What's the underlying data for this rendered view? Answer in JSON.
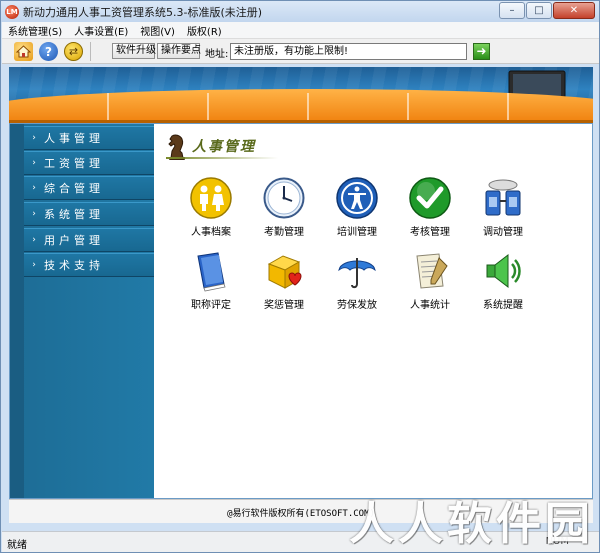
{
  "window": {
    "title": "新动力通用人事工资管理系统5.3-标准版(未注册)",
    "minimize": "–",
    "maximize": "□",
    "close": "✕"
  },
  "menu": [
    "系统管理(S)",
    "人事设置(E)",
    "视图(V)",
    "版权(R)"
  ],
  "toolbar": {
    "upgrade_label": "软件升级",
    "points_label": "操作要点",
    "address_label": "地址:",
    "address_value": "未注册版，有功能上限制!",
    "go_icon": "arrow-right-icon"
  },
  "sidebar": {
    "items": [
      {
        "label": "人事管理"
      },
      {
        "label": "工资管理"
      },
      {
        "label": "综合管理"
      },
      {
        "label": "系统管理"
      },
      {
        "label": "用户管理"
      },
      {
        "label": "技术支持"
      }
    ]
  },
  "content": {
    "section_title": "人事管理",
    "items": [
      {
        "label": "人事档案",
        "icon": "people-icon"
      },
      {
        "label": "考勤管理",
        "icon": "clock-icon"
      },
      {
        "label": "培训管理",
        "icon": "accessibility-icon"
      },
      {
        "label": "考核管理",
        "icon": "check-icon"
      },
      {
        "label": "调动管理",
        "icon": "transfer-icon"
      },
      {
        "label": "职称评定",
        "icon": "book-icon"
      },
      {
        "label": "奖惩管理",
        "icon": "gift-icon"
      },
      {
        "label": "劳保发放",
        "icon": "umbrella-icon"
      },
      {
        "label": "人事统计",
        "icon": "report-icon"
      },
      {
        "label": "系统提醒",
        "icon": "speaker-icon"
      }
    ]
  },
  "footer": {
    "copyright": "@易行软件版权所有(ETOSOFT.COM)",
    "status": "就绪",
    "num": "NUM",
    "watermark": "人人软件园"
  },
  "colors": {
    "sidebar": "#1f77a4",
    "banner_orange": "#f0820f",
    "banner_blue": "#2e82c0",
    "section_title": "#5a6a1c"
  }
}
